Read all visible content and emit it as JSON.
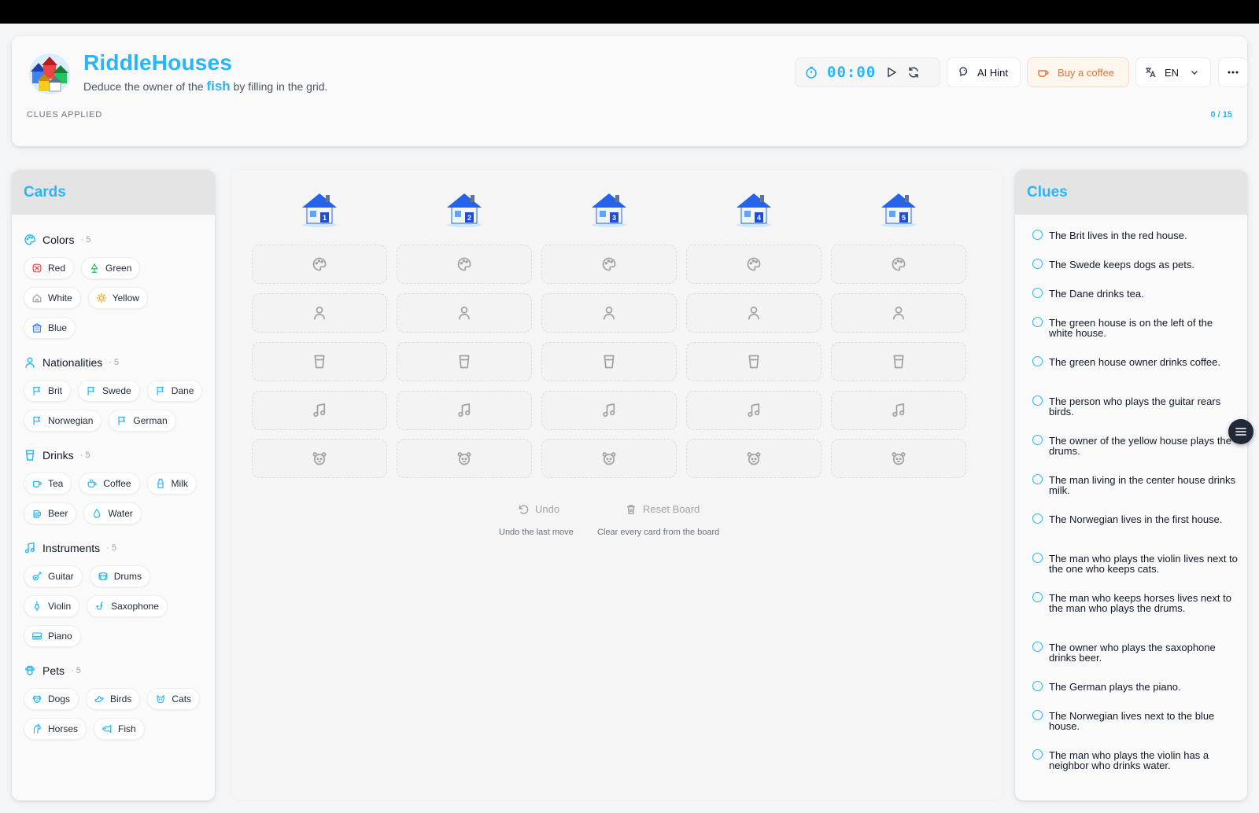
{
  "header": {
    "title": "RiddleHouses",
    "subtitle_prefix": "Deduce the owner of the ",
    "subtitle_highlight": "fish",
    "subtitle_suffix": " by filling in the grid.",
    "clues_applied_label": "CLUES APPLIED",
    "clues_applied_count": "0 / 15",
    "timer": "00:00",
    "hint_label": "AI Hint",
    "coffee_label": "Buy a coffee",
    "language": "EN"
  },
  "colors": {
    "accent": "#29b6f6",
    "coffee": "#d9773c"
  },
  "cards_panel": {
    "title": "Cards",
    "categories": [
      {
        "name": "Colors",
        "count": "· 5",
        "icon": "palette-icon",
        "items": [
          {
            "label": "Red",
            "icon": "red-swatch-icon"
          },
          {
            "label": "Green",
            "icon": "tree-icon"
          },
          {
            "label": "White",
            "icon": "house-outline-icon"
          },
          {
            "label": "Yellow",
            "icon": "sun-icon"
          },
          {
            "label": "Blue",
            "icon": "building-icon"
          }
        ]
      },
      {
        "name": "Nationalities",
        "count": "· 5",
        "icon": "person-icon",
        "items": [
          {
            "label": "Brit",
            "icon": "flag-icon"
          },
          {
            "label": "Swede",
            "icon": "flag-icon"
          },
          {
            "label": "Dane",
            "icon": "flag-icon"
          },
          {
            "label": "Norwegian",
            "icon": "flag-icon"
          },
          {
            "label": "German",
            "icon": "flag-icon"
          }
        ]
      },
      {
        "name": "Drinks",
        "count": "· 5",
        "icon": "cup-icon",
        "items": [
          {
            "label": "Tea",
            "icon": "mug-icon"
          },
          {
            "label": "Coffee",
            "icon": "coffee-icon"
          },
          {
            "label": "Milk",
            "icon": "milk-bottle-icon"
          },
          {
            "label": "Beer",
            "icon": "beer-icon"
          },
          {
            "label": "Water",
            "icon": "droplet-icon"
          }
        ]
      },
      {
        "name": "Instruments",
        "count": "· 5",
        "icon": "music-note-icon",
        "items": [
          {
            "label": "Guitar",
            "icon": "guitar-icon"
          },
          {
            "label": "Drums",
            "icon": "drum-icon"
          },
          {
            "label": "Violin",
            "icon": "violin-icon"
          },
          {
            "label": "Saxophone",
            "icon": "saxophone-icon"
          },
          {
            "label": "Piano",
            "icon": "piano-icon"
          }
        ]
      },
      {
        "name": "Pets",
        "count": "· 5",
        "icon": "paw-icon",
        "items": [
          {
            "label": "Dogs",
            "icon": "dog-icon"
          },
          {
            "label": "Birds",
            "icon": "bird-icon"
          },
          {
            "label": "Cats",
            "icon": "cat-icon"
          },
          {
            "label": "Horses",
            "icon": "horse-icon"
          },
          {
            "label": "Fish",
            "icon": "fish-icon"
          }
        ]
      }
    ]
  },
  "board": {
    "houses": [
      "1",
      "2",
      "3",
      "4",
      "5"
    ],
    "slot_icons": [
      "palette-icon",
      "person-icon",
      "cup-icon",
      "music-note-icon",
      "pet-face-icon"
    ],
    "undo_label": "Undo",
    "undo_desc": "Undo the last move",
    "reset_label": "Reset Board",
    "reset_desc": "Clear every card from the board"
  },
  "clues_panel": {
    "title": "Clues",
    "clues": [
      "The Brit lives in the red house.",
      "The Swede keeps dogs as pets.",
      "The Dane drinks tea.",
      "The green house is on the left of the white house.",
      "The green house owner drinks coffee.",
      "The person who plays the guitar rears birds.",
      "The owner of the yellow house plays the drums.",
      "The man living in the center house drinks milk.",
      "The Norwegian lives in the first house.",
      "The man who plays the violin lives next to the one who keeps cats.",
      "The man who keeps horses lives next to the man who plays the drums.",
      "The owner who plays the saxophone drinks beer.",
      "The German plays the piano.",
      "The Norwegian lives next to the blue house.",
      "The man who plays the violin has a neighbor who drinks water."
    ]
  }
}
